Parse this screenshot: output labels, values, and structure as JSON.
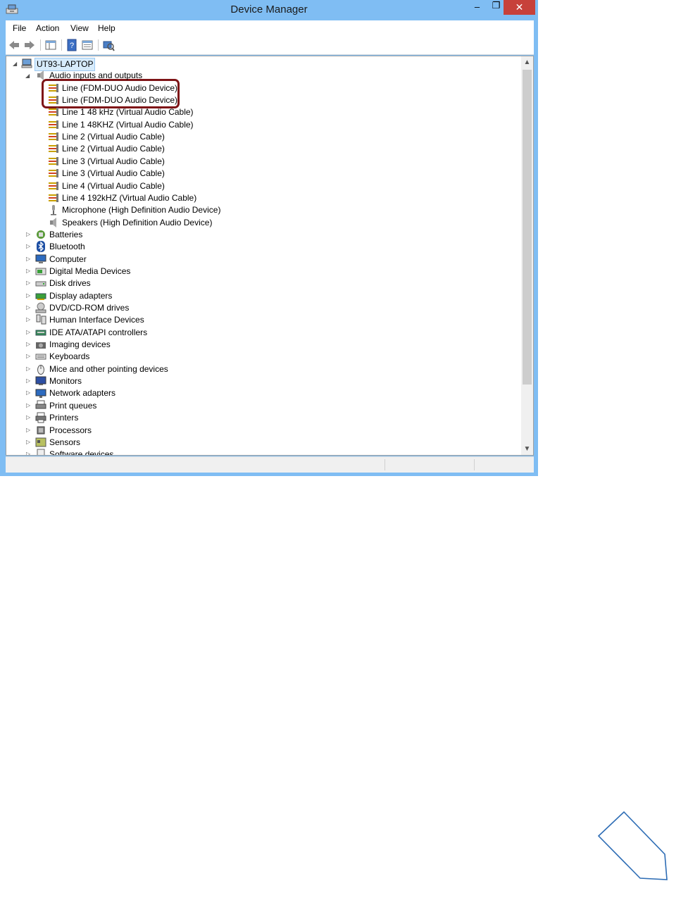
{
  "window": {
    "title": "Device Manager"
  },
  "controls": {
    "minimize": "–",
    "maximize": "❐",
    "close": "✕"
  },
  "menu": [
    "File",
    "Action",
    "View",
    "Help"
  ],
  "toolbar": [
    "back-icon",
    "forward-icon",
    "show-hide-console-tree-icon",
    "help-icon",
    "properties-icon",
    "scan-hardware-icon"
  ],
  "tree": {
    "root": "UT93-LAPTOP",
    "expanded_category": "Audio inputs and outputs",
    "audio_children": [
      {
        "label": "Line (FDM-DUO Audio Device)",
        "icon": "audio-line-icon"
      },
      {
        "label": "Line (FDM-DUO Audio Device)",
        "icon": "audio-line-icon"
      },
      {
        "label": "Line 1 48 kHz (Virtual Audio Cable)",
        "icon": "audio-line-icon"
      },
      {
        "label": "Line 1 48KHZ (Virtual Audio Cable)",
        "icon": "audio-line-icon"
      },
      {
        "label": "Line 2 (Virtual Audio Cable)",
        "icon": "audio-line-icon"
      },
      {
        "label": "Line 2 (Virtual Audio Cable)",
        "icon": "audio-line-icon"
      },
      {
        "label": "Line 3 (Virtual Audio Cable)",
        "icon": "audio-line-icon"
      },
      {
        "label": "Line 3 (Virtual Audio Cable)",
        "icon": "audio-line-icon"
      },
      {
        "label": "Line 4 (Virtual Audio Cable)",
        "icon": "audio-line-icon"
      },
      {
        "label": "Line 4 192kHZ (Virtual Audio Cable)",
        "icon": "audio-line-icon"
      },
      {
        "label": "Microphone (High Definition Audio Device)",
        "icon": "microphone-icon"
      },
      {
        "label": "Speakers (High Definition Audio Device)",
        "icon": "speaker-icon"
      }
    ],
    "categories": [
      {
        "label": "Batteries",
        "icon": "battery-icon"
      },
      {
        "label": "Bluetooth",
        "icon": "bluetooth-icon"
      },
      {
        "label": "Computer",
        "icon": "computer-icon"
      },
      {
        "label": "Digital Media Devices",
        "icon": "media-device-icon"
      },
      {
        "label": "Disk drives",
        "icon": "disk-drive-icon"
      },
      {
        "label": "Display adapters",
        "icon": "display-adapter-icon"
      },
      {
        "label": "DVD/CD-ROM drives",
        "icon": "dvd-drive-icon"
      },
      {
        "label": "Human Interface Devices",
        "icon": "hid-icon"
      },
      {
        "label": "IDE ATA/ATAPI controllers",
        "icon": "ide-controller-icon"
      },
      {
        "label": "Imaging devices",
        "icon": "camera-icon"
      },
      {
        "label": "Keyboards",
        "icon": "keyboard-icon"
      },
      {
        "label": "Mice and other pointing devices",
        "icon": "mouse-icon"
      },
      {
        "label": "Monitors",
        "icon": "monitor-icon"
      },
      {
        "label": "Network adapters",
        "icon": "network-adapter-icon"
      },
      {
        "label": "Print queues",
        "icon": "print-queue-icon"
      },
      {
        "label": "Printers",
        "icon": "printer-icon"
      },
      {
        "label": "Processors",
        "icon": "processor-icon"
      },
      {
        "label": "Sensors",
        "icon": "sensor-icon"
      },
      {
        "label": "Software devices",
        "icon": "software-device-icon"
      }
    ]
  },
  "colors": {
    "titlebar": "#7fbdf3",
    "close": "#c7413a",
    "highlight": "#7e1417",
    "pencil": "#2e6db5"
  }
}
